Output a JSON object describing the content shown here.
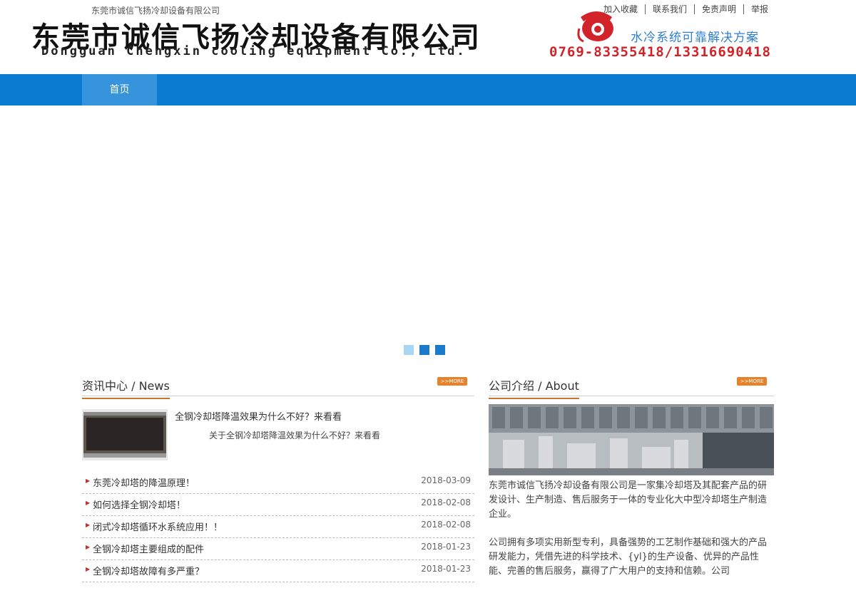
{
  "header": {
    "company_small": "东莞市诚信飞扬冷却设备有限公司",
    "logo_cn": "东莞市诚信飞扬冷却设备有限公司",
    "logo_en": "Dongguan Chengxin cooling equipment Co., Ltd.",
    "top_links": [
      "加入收藏",
      "联系我们",
      "免责声明",
      "举报"
    ],
    "slogan": "水冷系统可靠解决方案",
    "hotline": "0769-83355418/13316690418",
    "phone_icon": "telephone-icon",
    "accent": "#d2232a"
  },
  "nav": {
    "items": [
      "首页"
    ],
    "bg": "#0a7bd1"
  },
  "news": {
    "title_cn": "资讯中心",
    "title_en": " / News",
    "more": ">>MORE",
    "featured": {
      "title": "全钢冷却塔降温效果为什么不好？来看看",
      "desc": "关于全钢冷却塔降温效果为什么不好？来看看"
    },
    "items": [
      {
        "title": "东莞冷却塔的降温原理！",
        "date": "2018-03-09"
      },
      {
        "title": "如何选择全钢冷却塔！",
        "date": "2018-02-08"
      },
      {
        "title": "闭式冷却塔循环水系统应用！！",
        "date": "2018-02-08"
      },
      {
        "title": "全钢冷却塔主要组成的配件",
        "date": "2018-01-23"
      },
      {
        "title": "全钢冷却塔故障有多严重？",
        "date": "2018-01-23"
      }
    ]
  },
  "about": {
    "title_cn": "公司介绍",
    "title_en": " / About",
    "more": ">>MORE",
    "p1": "东莞市诚信飞扬冷却设备有限公司是一家集冷却塔及其配套产品的研发设计、生产制造、售后服务于一体的专业化大中型冷却塔生产制造企业。",
    "p2": "公司拥有多项实用新型专利，具备强势的工艺制作基础和强大的产品研发能力，凭借先进的科学技术、{yl}的生产设备、优异的产品性能、完善的售后服务，赢得了广大用户的支持和信赖。公司"
  }
}
